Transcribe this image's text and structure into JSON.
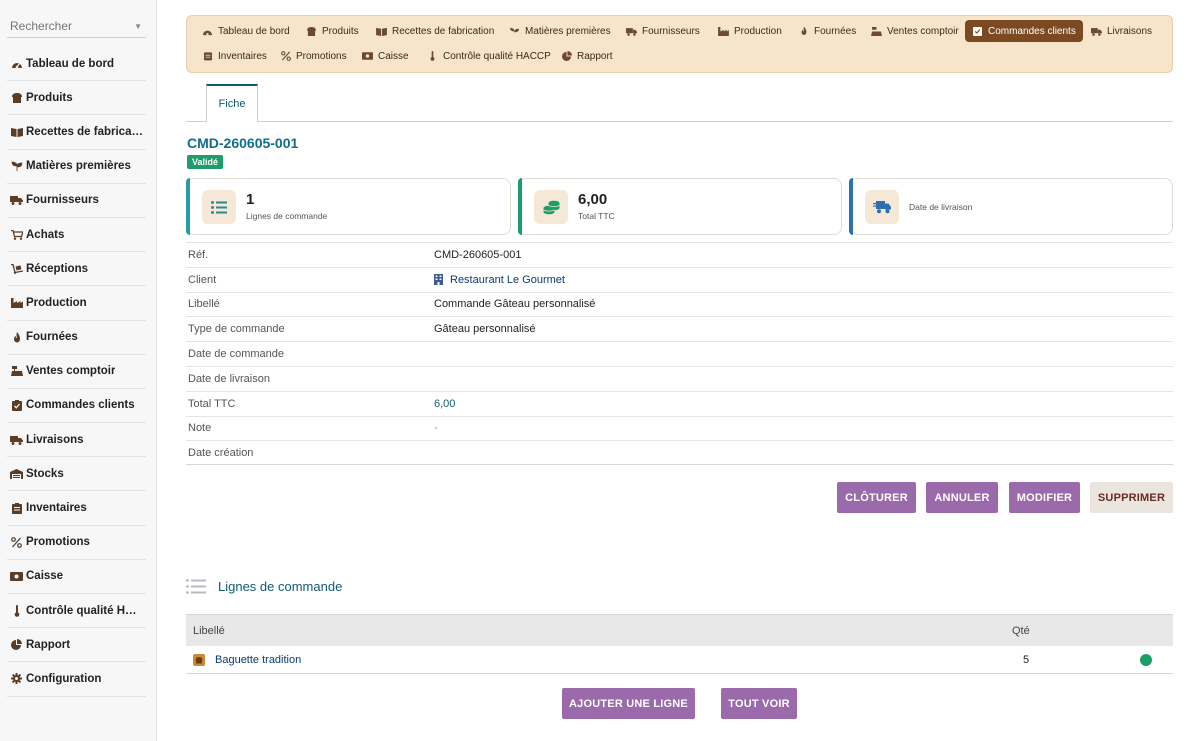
{
  "sidebar": {
    "search_placeholder": "Rechercher",
    "items": [
      {
        "label": "Tableau de bord",
        "icon": "dashboard-icon"
      },
      {
        "label": "Produits",
        "icon": "bread-icon"
      },
      {
        "label": "Recettes de fabrication",
        "icon": "book-icon"
      },
      {
        "label": "Matières premières",
        "icon": "seedling-icon"
      },
      {
        "label": "Fournisseurs",
        "icon": "truck-icon"
      },
      {
        "label": "Achats",
        "icon": "cart-icon"
      },
      {
        "label": "Réceptions",
        "icon": "dolly-icon"
      },
      {
        "label": "Production",
        "icon": "industry-icon"
      },
      {
        "label": "Fournées",
        "icon": "fire-icon"
      },
      {
        "label": "Ventes comptoir",
        "icon": "cash-register-icon"
      },
      {
        "label": "Commandes clients",
        "icon": "clipboard-check-icon"
      },
      {
        "label": "Livraisons",
        "icon": "shipping-icon"
      },
      {
        "label": "Stocks",
        "icon": "warehouse-icon"
      },
      {
        "label": "Inventaires",
        "icon": "clipboard-list-icon"
      },
      {
        "label": "Promotions",
        "icon": "percent-icon"
      },
      {
        "label": "Caisse",
        "icon": "money-icon"
      },
      {
        "label": "Contrôle qualité HACCP",
        "icon": "thermometer-icon"
      },
      {
        "label": "Rapport",
        "icon": "pie-chart-icon"
      },
      {
        "label": "Configuration",
        "icon": "gear-icon"
      }
    ]
  },
  "topnav": {
    "items": [
      {
        "label": "Tableau de bord",
        "icon": "dashboard-icon"
      },
      {
        "label": "Produits",
        "icon": "bread-icon"
      },
      {
        "label": "Recettes de fabrication",
        "icon": "book-icon"
      },
      {
        "label": "Matières premières",
        "icon": "seedling-icon"
      },
      {
        "label": "Fournisseurs",
        "icon": "truck-icon"
      },
      {
        "label": "Production",
        "icon": "industry-icon"
      },
      {
        "label": "Fournées",
        "icon": "fire-icon"
      },
      {
        "label": "Ventes comptoir",
        "icon": "cash-register-icon"
      },
      {
        "label": "Commandes clients",
        "icon": "clipboard-check-icon",
        "active": true
      },
      {
        "label": "Livraisons",
        "icon": "shipping-icon"
      },
      {
        "label": "Inventaires",
        "icon": "clipboard-list-icon"
      },
      {
        "label": "Promotions",
        "icon": "percent-icon"
      },
      {
        "label": "Caisse",
        "icon": "money-icon"
      },
      {
        "label": "Contrôle qualité HACCP",
        "icon": "thermometer-icon"
      },
      {
        "label": "Rapport",
        "icon": "pie-chart-icon"
      }
    ]
  },
  "tabs": {
    "fiche": "Fiche"
  },
  "record": {
    "ref": "CMD-260605-001",
    "status": "Validé",
    "status_color": "#1f9c6b"
  },
  "cards": [
    {
      "value": "1",
      "label": "Lignes de commande",
      "accent": "#2a9aa3",
      "icon": "list-icon"
    },
    {
      "value": "6,00",
      "label": "Total TTC",
      "accent": "#1f9c6b",
      "icon": "coins-icon"
    },
    {
      "value": "",
      "label": "Date de livraison",
      "accent": "#2d6fb0",
      "icon": "truck-fast-icon"
    }
  ],
  "fields": [
    {
      "key": "Réf.",
      "value": "CMD-260605-001"
    },
    {
      "key": "Client",
      "value": "Restaurant Le Gourmet"
    },
    {
      "key": "Libellé",
      "value": "Commande Gâteau personnalisé"
    },
    {
      "key": "Type de commande",
      "value": "Gâteau personnalisé"
    },
    {
      "key": "Date de commande",
      "value": ""
    },
    {
      "key": "Date de livraison",
      "value": ""
    },
    {
      "key": "Total TTC",
      "value": "6,00"
    },
    {
      "key": "Note",
      "value": "-"
    },
    {
      "key": "Date création",
      "value": ""
    }
  ],
  "actions": {
    "cloturer": "CLÔTURER",
    "annuler": "ANNULER",
    "modifier": "MODIFIER",
    "supprimer": "SUPPRIMER"
  },
  "lines": {
    "title": "Lignes de commande",
    "col_libelle": "Libellé",
    "col_qte": "Qté",
    "rows": [
      {
        "label": "Baguette tradition",
        "qty": "5",
        "status_color": "#1f9c6b"
      }
    ],
    "add_button": "AJOUTER UNE LIGNE",
    "see_all_button": "TOUT VOIR"
  }
}
